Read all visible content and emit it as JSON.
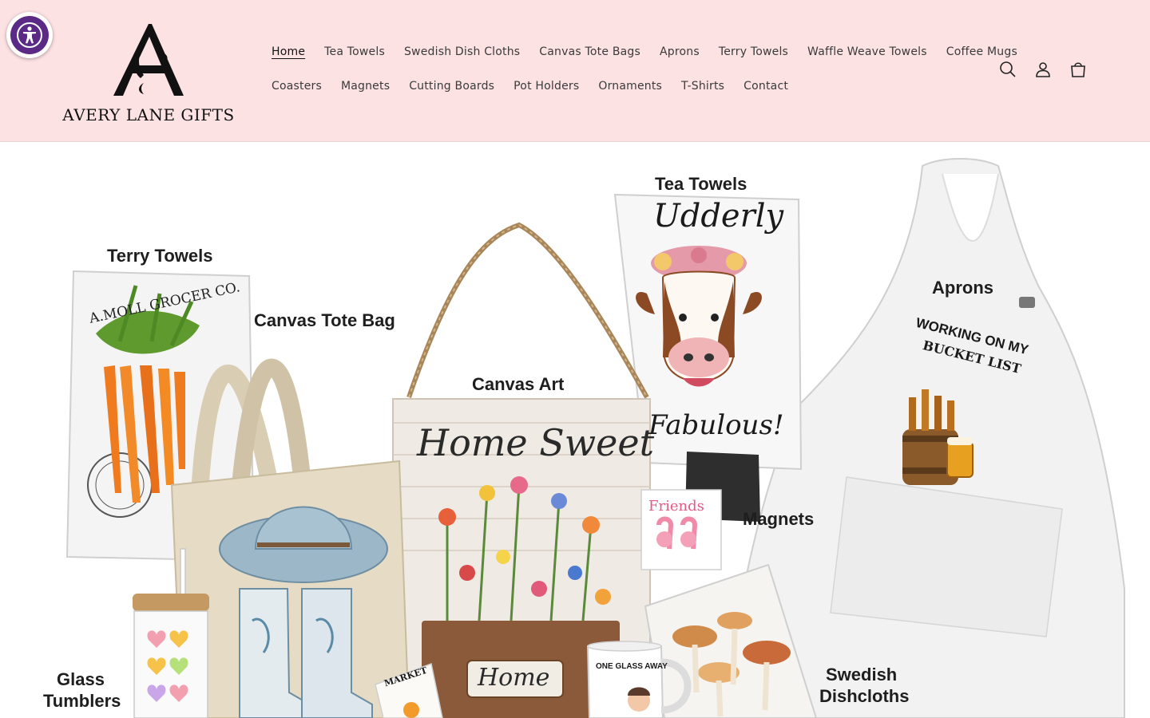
{
  "header": {
    "brand": "AVERY LANE GIFTS",
    "nav_row1": [
      "Home",
      "Tea Towels",
      "Swedish Dish Cloths",
      "Canvas Tote Bags",
      "Aprons",
      "Terry Towels",
      "Waffle Weave Towels",
      "Coffee Mugs"
    ],
    "nav_row2": [
      "Coasters",
      "Magnets",
      "Cutting Boards",
      "Pot Holders",
      "Ornaments",
      "T-Shirts",
      "Contact"
    ],
    "active": "Home",
    "icons": [
      "search-icon",
      "account-icon",
      "cart-icon"
    ]
  },
  "hero": {
    "labels": {
      "terry": "Terry Towels",
      "tote": "Canvas Tote Bag",
      "canvas_art": "Canvas Art",
      "tea": "Tea Towels",
      "aprons": "Aprons",
      "magnets": "Magnets",
      "glass_1": "Glass",
      "glass_2": "Tumblers",
      "swedish_1": "Swedish",
      "swedish_2": "Dishcloths"
    },
    "product_text": {
      "grocer": "A.MOLL GROCER CO.",
      "udderly": "Udderly",
      "fabulous": "Fabulous!",
      "home_sweet": "Home Sweet",
      "home": "Home",
      "bucket_1": "WORKING ON MY",
      "bucket_2": "BUCKET LIST",
      "friends": "Friends",
      "mug": "ONE GLASS AWAY",
      "market": "MARKET"
    }
  },
  "colors": {
    "header_bg": "#fde2e4",
    "accessibility": "#5b2a86"
  }
}
